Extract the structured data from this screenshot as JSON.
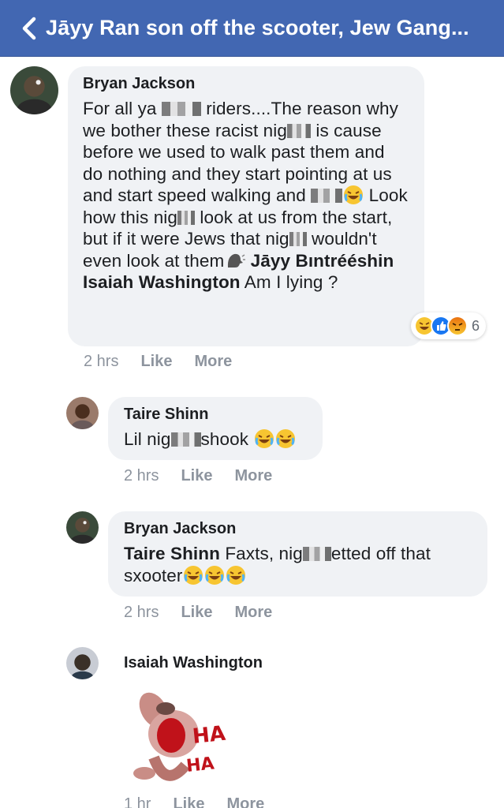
{
  "header": {
    "title": "Jāyy Ran son off the scooter, Jew Gang..."
  },
  "colors": {
    "header_bg": "#4267b2",
    "bubble_bg": "#f0f2f5",
    "meta": "#8d949e"
  },
  "comments": [
    {
      "author": "Bryan Jackson",
      "t1": "For all ya",
      "t2": "riders....The reason why we bother these racist nig",
      "t3": "is cause before we used to walk past them and do nothing and they start pointing at us and start speed walking and",
      "t4": "Look how this nig",
      "t5": "look at us from the start, but if it were Jews that nig",
      "t6": "wouldn't even look at them",
      "mention": "Jāyy Bıntrééshin Isaiah Washington",
      "t7": "Am I lying ?",
      "reaction_count": "6",
      "time": "2 hrs",
      "like": "Like",
      "more": "More"
    },
    {
      "author": "Taire Shinn",
      "t1": "Lil nig",
      "t2": "shook",
      "time": "2 hrs",
      "like": "Like",
      "more": "More"
    },
    {
      "author": "Bryan Jackson",
      "mention": "Taire Shinn",
      "t1": "Faxts, nig",
      "t2": "etted off that sxooter",
      "time": "2 hrs",
      "like": "Like",
      "more": "More"
    },
    {
      "author": "Isaiah Washington",
      "sticker_text": "HA HA",
      "time": "1 hr",
      "like": "Like",
      "more": "More"
    }
  ]
}
